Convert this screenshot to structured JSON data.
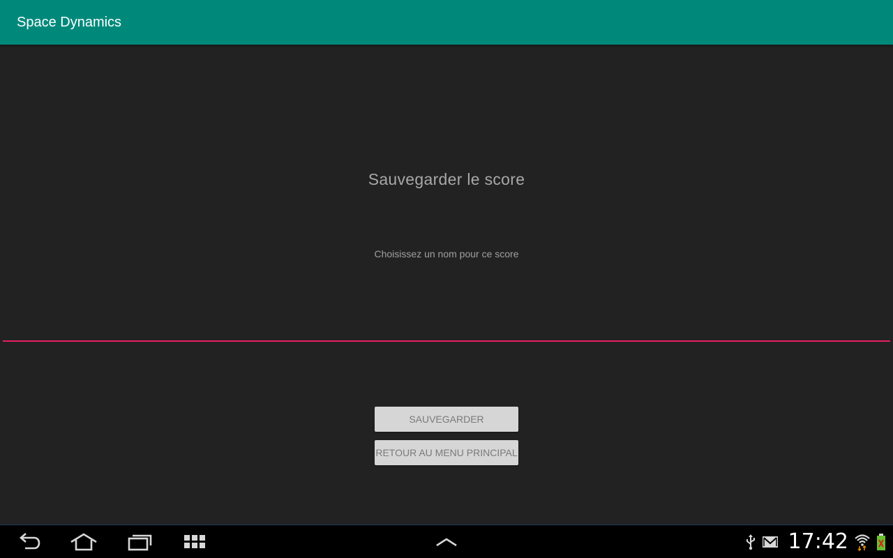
{
  "app": {
    "title": "Space Dynamics",
    "accent_color": "#00897b",
    "field_underline_color": "#e91e63"
  },
  "screen": {
    "heading": "Sauvegarder le score",
    "prompt": "Choisissez un nom pour ce score",
    "name_input": {
      "value": "",
      "placeholder": ""
    },
    "buttons": {
      "save_label": "SAUVEGARDER",
      "back_label": "RETOUR AU MENU PRINCIPAL"
    }
  },
  "system_bar": {
    "nav_icons": [
      "back-icon",
      "home-icon",
      "recent-apps-icon",
      "apps-grid-icon",
      "chevron-up-icon"
    ],
    "status_icons": [
      "usb-icon",
      "gmail-icon",
      "wifi-icon",
      "battery-icon"
    ],
    "clock": "17:42"
  }
}
